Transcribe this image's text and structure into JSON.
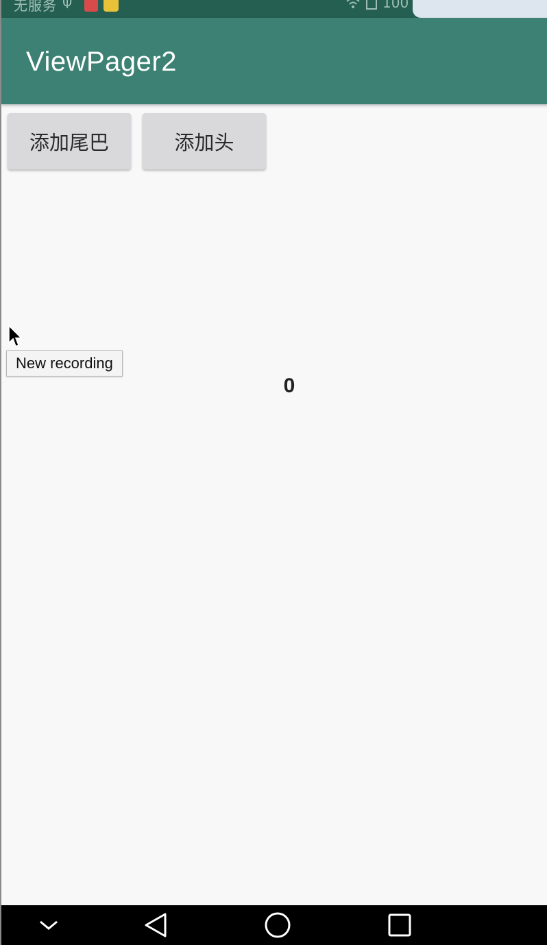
{
  "status_bar": {
    "carrier": "无服务",
    "battery": "100"
  },
  "app_bar": {
    "title": "ViewPager2"
  },
  "buttons": {
    "add_tail": "添加尾巴",
    "add_head": "添加头"
  },
  "pager": {
    "current_page": "0"
  },
  "tooltip": {
    "text": "New recording"
  },
  "icons": {
    "usb": "usb-icon",
    "cursor": "cursor-icon",
    "nav_hide": "chevron-down-icon",
    "nav_back": "back-triangle-icon",
    "nav_home": "home-circle-icon",
    "nav_recent": "recent-square-icon"
  },
  "colors": {
    "status_bar": "#255f52",
    "app_bar": "#3c8174",
    "background": "#f8f8f9",
    "button": "#d9d9db",
    "nav_bar": "#000000"
  }
}
